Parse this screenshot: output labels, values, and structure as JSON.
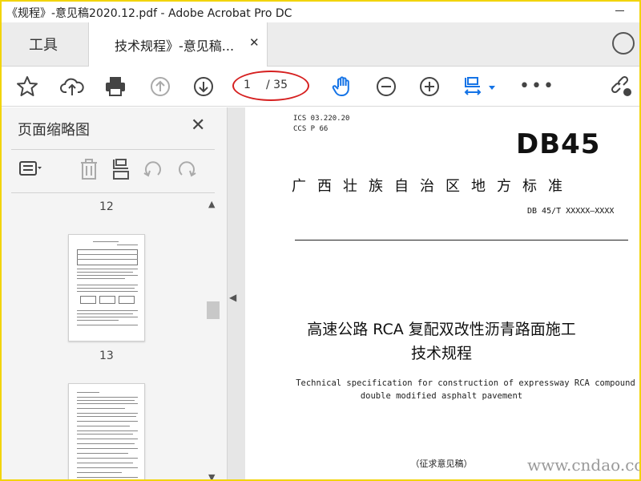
{
  "window": {
    "title": "《规程》-意见稿2020.12.pdf - Adobe Acrobat Pro DC"
  },
  "tabs": {
    "tools_label": "工具",
    "document_label": "技术规程》-意见稿...",
    "close_glyph": "✕"
  },
  "toolbar": {
    "icons": [
      "star-icon",
      "upload-icon",
      "print-icon",
      "page-up-icon",
      "page-down-icon",
      "hand-icon",
      "zoom-out-icon",
      "zoom-in-icon",
      "fit-page-icon",
      "more-icon",
      "share-link-icon"
    ],
    "current_page": "1",
    "total_pages": "/ 35",
    "more_glyph": "•••",
    "accent_color": "#1473e6",
    "annotation_color": "#d62020"
  },
  "thumbnail_panel": {
    "title": "页面缩略图",
    "close_glyph": "✕",
    "page_labels": [
      "12",
      "13"
    ]
  },
  "document": {
    "ics": "ICS  03.220.20",
    "ccs": "CCS P 66",
    "standard_mark": "DB45",
    "region_title": "广西壮族自治区地方标准",
    "code": "DB 45/T XXXXX—XXXX",
    "title_line1": "高速公路 RCA 复配双改性沥青路面施工",
    "title_line2": "技术规程",
    "english_line1": "Technical specification for construction of expressway RCA compound",
    "english_line2": "double modified asphalt pavement",
    "draft_label": "（征求意见稿）"
  },
  "watermark": "www.cndao.com"
}
